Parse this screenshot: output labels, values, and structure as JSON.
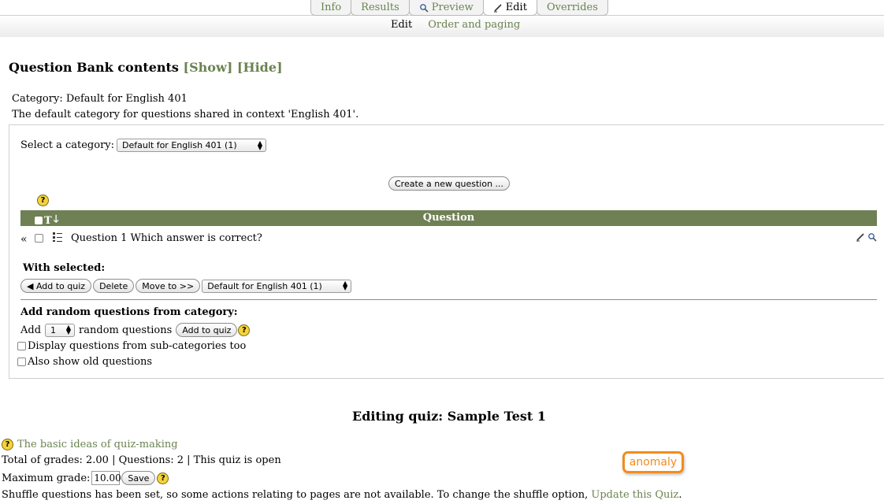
{
  "tabs": [
    {
      "label": "Info",
      "icon": "",
      "active": false
    },
    {
      "label": "Results",
      "icon": "",
      "active": false
    },
    {
      "label": "Preview",
      "icon": "magnifier-icon",
      "active": false
    },
    {
      "label": "Edit",
      "icon": "pencil-icon",
      "active": true
    },
    {
      "label": "Overrides",
      "icon": "",
      "active": false
    }
  ],
  "subtabs": {
    "edit": "Edit",
    "order": "Order and paging"
  },
  "question_bank": {
    "title": "Question Bank contents",
    "show": "[Show]",
    "hide": "[Hide]",
    "category_line": "Category: Default for English 401",
    "category_desc": "The default category for questions shared in context 'English 401'.",
    "select_label": "Select a category:",
    "selected_category": "Default for English 401 (1)",
    "create_button": "Create a new question ...",
    "help": "?",
    "header_t": "T",
    "header_question": "Question",
    "questions": [
      {
        "add": "«",
        "text": "Question 1 Which answer is correct?"
      }
    ],
    "with_selected": "With selected:",
    "add_to_quiz": "◀ Add to quiz",
    "delete": "Delete",
    "move_to": "Move to >>",
    "move_category": "Default for English 401 (1)",
    "add_random_title": "Add random questions from category:",
    "add_label": "Add",
    "random_count": "1",
    "random_label": "random questions",
    "add_random_button": "Add to quiz",
    "subcat_label": "Display questions from sub-categories too",
    "old_label": "Also show old questions"
  },
  "quiz": {
    "title": "Editing quiz: Sample Test 1",
    "basic_link": "The basic ideas of quiz-making",
    "totals": "Total of grades: 2.00 | Questions: 2 | This quiz is open",
    "max_grade_label": "Maximum grade:",
    "max_grade_value": "10.00",
    "save": "Save",
    "shuffle_text": "Shuffle questions has been set, so some actions relating to pages are not available. To change the shuffle option, ",
    "update_link": "Update this Quiz",
    "shuffle_end": "."
  },
  "badge": "anomaly",
  "colors": {
    "accent": "#6f8054",
    "link": "#6a8350",
    "badge": "#f28c1b"
  }
}
